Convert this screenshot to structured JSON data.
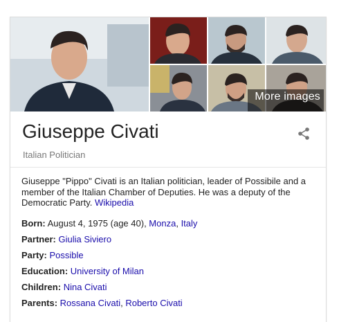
{
  "gallery": {
    "more_images_label": "More images"
  },
  "header": {
    "name": "Giuseppe Civati",
    "subtitle": "Italian Politician"
  },
  "description": {
    "text": "Giuseppe \"Pippo\" Civati is an Italian politician, leader of Possibile and a member of the Italian Chamber of Deputies. He was a deputy of the Democratic Party.",
    "source_link": "Wikipedia"
  },
  "facts": {
    "born": {
      "label": "Born:",
      "text": "August 4, 1975 (age 40), ",
      "link1": "Monza",
      "sep": ", ",
      "link2": "Italy"
    },
    "partner": {
      "label": "Partner:",
      "link": "Giulia Siviero"
    },
    "party": {
      "label": "Party:",
      "link": "Possible"
    },
    "education": {
      "label": "Education:",
      "link": "University of Milan"
    },
    "children": {
      "label": "Children:",
      "link": "Nina Civati"
    },
    "parents": {
      "label": "Parents:",
      "link1": "Rossana Civati",
      "sep": ", ",
      "link2": "Roberto Civati"
    }
  },
  "colors": {
    "link": "#1a0dab",
    "text": "#222222",
    "muted": "#777777"
  },
  "icons": [
    "share-icon"
  ]
}
